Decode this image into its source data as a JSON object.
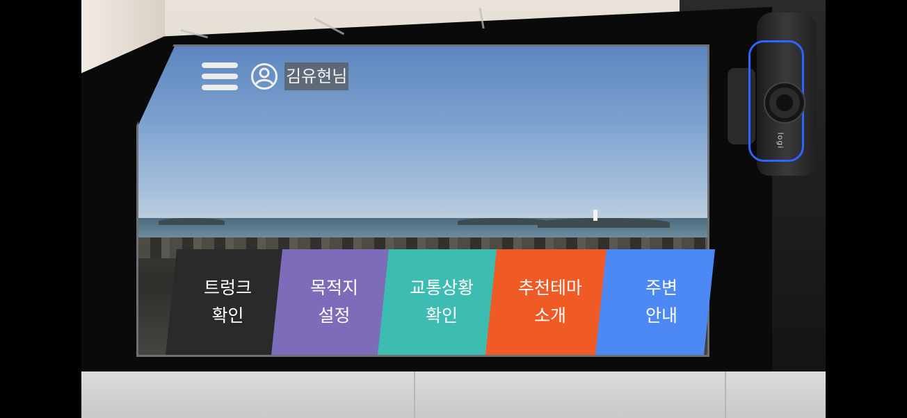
{
  "header": {
    "user_name": "김유현님"
  },
  "tiles": [
    {
      "line1": "트렁크",
      "line2": "확인",
      "color": "#2b2a2b"
    },
    {
      "line1": "목적지",
      "line2": "설정",
      "color": "#7c6cb9"
    },
    {
      "line1": "교통상황",
      "line2": "확인",
      "color": "#3dbdb1"
    },
    {
      "line1": "추천테마",
      "line2": "소개",
      "color": "#ef5a25"
    },
    {
      "line1": "주변",
      "line2": "안내",
      "color": "#4d89f5"
    }
  ],
  "webcam": {
    "brand": "logi",
    "accent_color": "#2f64ff"
  }
}
